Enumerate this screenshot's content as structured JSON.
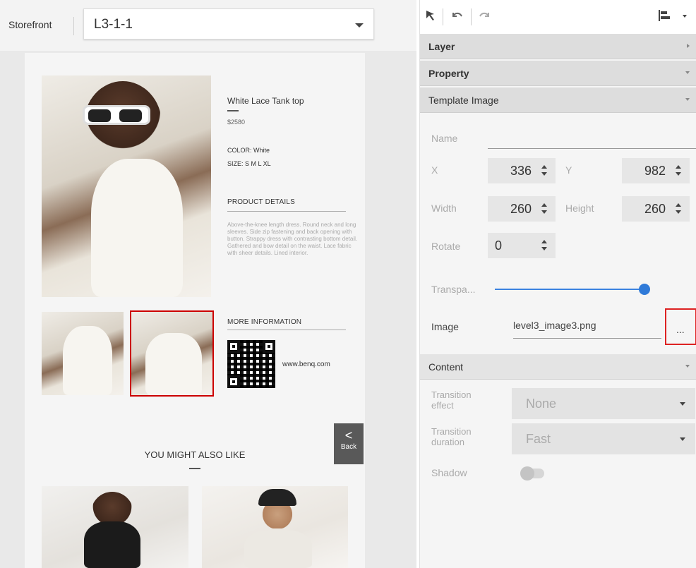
{
  "topbar": {
    "store_label": "Storefront",
    "page_value": "L3-1-1"
  },
  "product": {
    "name": "White Lace Tank top",
    "price": "$2580",
    "color": "COLOR: White",
    "size": "SIZE: S M L XL",
    "details_heading": "PRODUCT DETAILS",
    "description": "Above-the-knee length dress. Round neck and long sleeves. Side zip fastening and back opening with button. Strappy dress with contrasting bottom detail. Gathered and bow detail on the waist. Lace fabric with sheer details. Lined interior.",
    "more_info_heading": "MORE INFORMATION",
    "website": "www.benq.com",
    "also_like": "YOU MIGHT ALSO LIKE"
  },
  "back": {
    "arrow": "<",
    "label": "Back"
  },
  "toolbar": {
    "icons": [
      "pointer-icon",
      "undo-icon",
      "redo-icon",
      "align-icon"
    ]
  },
  "panel": {
    "sections": {
      "layer": "Layer",
      "property": "Property",
      "template_image": "Template Image",
      "content": "Content"
    },
    "fields": {
      "name_label": "Name",
      "x_label": "X",
      "x_value": "336",
      "y_label": "Y",
      "y_value": "982",
      "width_label": "Width",
      "width_value": "260",
      "height_label": "Height",
      "height_value": "260",
      "rotate_label": "Rotate",
      "rotate_value": "0",
      "transparency_label": "Transpa...",
      "transparency_level": 1.0,
      "image_label": "Image",
      "image_value": "level3_image3.png",
      "browse_label": "..."
    },
    "content": {
      "effect_label": "Transition effect",
      "effect_value": "None",
      "duration_label": "Transition duration",
      "duration_value": "Fast",
      "shadow_label": "Shadow",
      "shadow_on": false
    }
  },
  "colors": {
    "accent": "#2f7ad8",
    "highlight": "#d22222",
    "back_button": "#595959"
  }
}
